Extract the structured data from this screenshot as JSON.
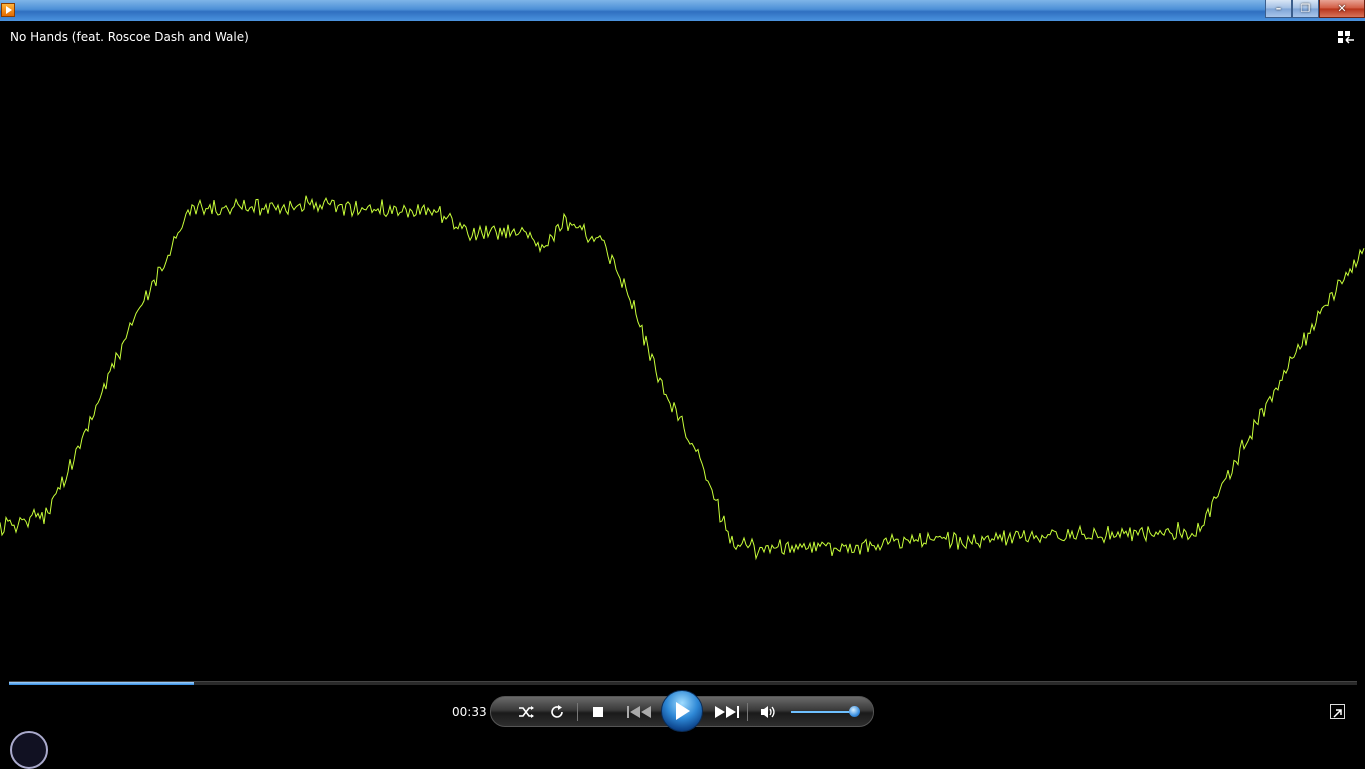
{
  "window": {
    "title_text": "",
    "controls": {
      "minimize": "–",
      "restore": "❐",
      "close": "✕"
    }
  },
  "player": {
    "track_title": "No Hands (feat. Roscoe Dash and Wale)",
    "elapsed": "00:33",
    "seek_fraction": 0.137,
    "volume_fraction": 0.98,
    "visualization_color": "#c8ff3a",
    "accent_color": "#2f8ae0"
  },
  "icons": {
    "shuffle": "shuffle-icon",
    "repeat": "repeat-icon",
    "stop": "stop-icon",
    "previous": "previous-icon",
    "play": "play-icon",
    "next": "next-icon",
    "mute": "speaker-icon",
    "library": "switch-to-library-icon",
    "fullscreen": "fullscreen-icon"
  }
}
